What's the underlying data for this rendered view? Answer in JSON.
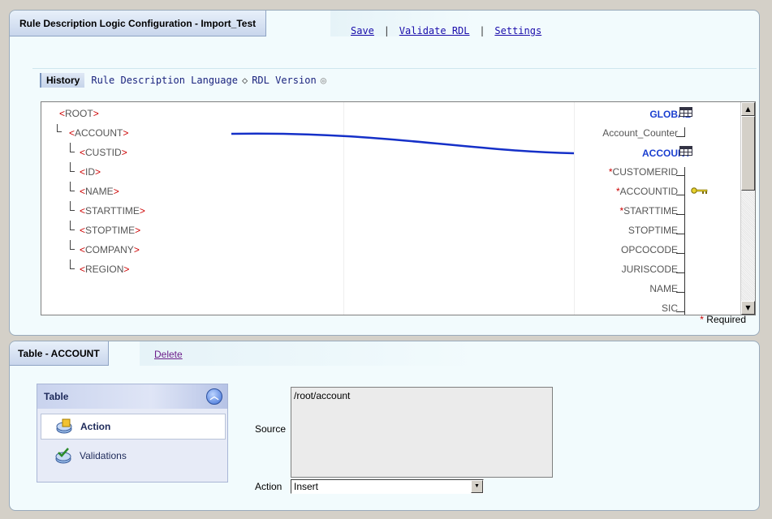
{
  "header": {
    "title": "Rule Description Logic Configuration - Import_Test",
    "links": {
      "save": "Save",
      "validate": "Validate RDL",
      "settings": "Settings",
      "separator": "|"
    }
  },
  "history_bar": {
    "history_tab": "History",
    "rdl_label": "Rule Description Language",
    "version_label": "RDL Version",
    "diamond_glyph": "◇",
    "radio_glyph": "◎"
  },
  "source_tree": {
    "nodes": [
      "<ROOT>",
      "<ACCOUNT>",
      "<CUSTID>",
      "<ID>",
      "<NAME>",
      "<STARTTIME>",
      "<STOPTIME>",
      "<COMPANY>",
      "<REGION>"
    ]
  },
  "target": {
    "global_table": "GLOBAL",
    "global_fields": [
      "Account_Counter"
    ],
    "account_table": "ACCOUNT",
    "account_fields": [
      {
        "name": "CUSTOMERID",
        "required": true
      },
      {
        "name": "ACCOUNTID",
        "required": true,
        "key": true
      },
      {
        "name": "STARTTIME",
        "required": true
      },
      {
        "name": "STOPTIME",
        "required": false
      },
      {
        "name": "OPCOCODE",
        "required": false
      },
      {
        "name": "JURISCODE",
        "required": false
      },
      {
        "name": "NAME",
        "required": false
      },
      {
        "name": "SIC",
        "required": false
      }
    ],
    "required_marker": "*"
  },
  "required_note": "Required",
  "table_panel": {
    "title": "Table - ACCOUNT",
    "delete_label": "Delete",
    "nav": {
      "header": "Table",
      "items": [
        "Action",
        "Validations"
      ]
    },
    "source_label": "Source",
    "source_value": "/root/account",
    "action_label": "Action",
    "action_value": "Insert"
  },
  "colors": {
    "accent_blue": "#1a3fd0",
    "required_red": "#cc0000",
    "link_blue": "#1a0dab",
    "link_visited": "#6b1d8a"
  }
}
